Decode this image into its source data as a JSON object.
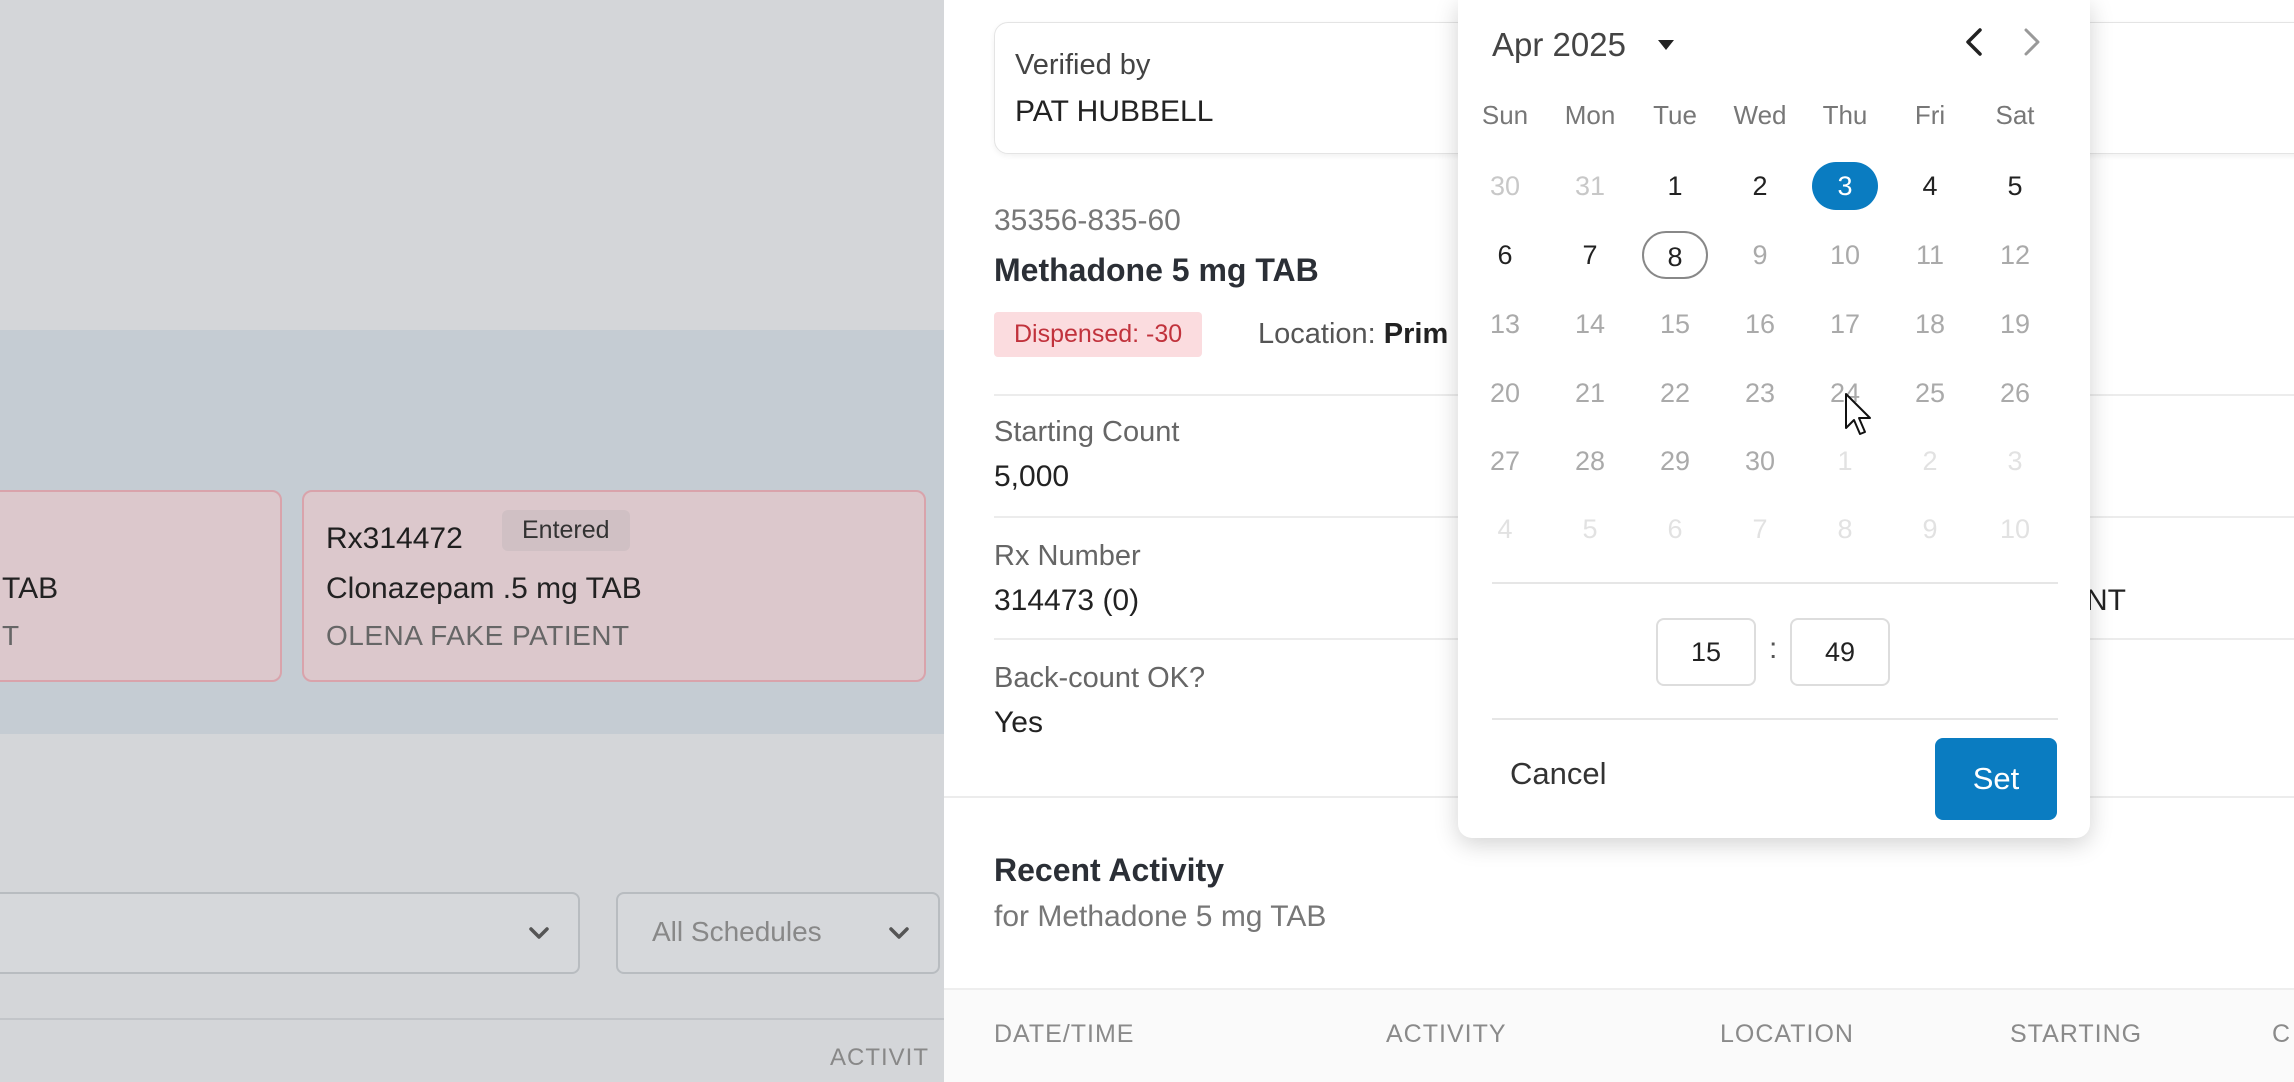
{
  "background": {
    "card_left": {
      "drug_fragment": "TAB",
      "patient_fragment": "T"
    },
    "card_right": {
      "rx_number": "Rx314472",
      "status": "Entered",
      "drug": "Clonazepam .5 mg TAB",
      "patient": "OLENA FAKE PATIENT"
    },
    "schedule_select": {
      "value": "All Schedules"
    },
    "column_fragment": "ACTIVIT"
  },
  "panel": {
    "verified_label": "Verified by",
    "verified_value": "PAT HUBBELL",
    "ndc": "35356-835-60",
    "drug_title": "Methadone 5 mg TAB",
    "dispensed_badge": "Dispensed: -30",
    "location_label": "Location:",
    "location_value": "Prim",
    "starting_count_label": "Starting Count",
    "starting_count_value": "5,000",
    "rx_number_label": "Rx Number",
    "rx_number_value": "314473 (0)",
    "right_fragment": "NT",
    "backcount_label": "Back-count OK?",
    "backcount_value": "Yes",
    "recent_title": "Recent Activity",
    "recent_subtitle": "for Methadone 5 mg TAB",
    "table_headers": [
      "DATE/TIME",
      "ACTIVITY",
      "LOCATION",
      "STARTING",
      "C"
    ]
  },
  "date_picker": {
    "month_label": "Apr 2025",
    "weekdays": [
      "Sun",
      "Mon",
      "Tue",
      "Wed",
      "Thu",
      "Fri",
      "Sat"
    ],
    "weeks": [
      [
        {
          "d": "30",
          "s": "muted"
        },
        {
          "d": "31",
          "s": "muted"
        },
        {
          "d": "1",
          "s": "normal"
        },
        {
          "d": "2",
          "s": "normal"
        },
        {
          "d": "3",
          "s": "selected"
        },
        {
          "d": "4",
          "s": "normal"
        },
        {
          "d": "5",
          "s": "normal"
        }
      ],
      [
        {
          "d": "6",
          "s": "normal"
        },
        {
          "d": "7",
          "s": "normal"
        },
        {
          "d": "8",
          "s": "today"
        },
        {
          "d": "9",
          "s": "gray"
        },
        {
          "d": "10",
          "s": "gray"
        },
        {
          "d": "11",
          "s": "gray"
        },
        {
          "d": "12",
          "s": "gray"
        }
      ],
      [
        {
          "d": "13",
          "s": "gray"
        },
        {
          "d": "14",
          "s": "gray"
        },
        {
          "d": "15",
          "s": "gray"
        },
        {
          "d": "16",
          "s": "gray"
        },
        {
          "d": "17",
          "s": "gray"
        },
        {
          "d": "18",
          "s": "gray"
        },
        {
          "d": "19",
          "s": "gray"
        }
      ],
      [
        {
          "d": "20",
          "s": "gray"
        },
        {
          "d": "21",
          "s": "gray"
        },
        {
          "d": "22",
          "s": "gray"
        },
        {
          "d": "23",
          "s": "gray"
        },
        {
          "d": "24",
          "s": "gray"
        },
        {
          "d": "25",
          "s": "gray"
        },
        {
          "d": "26",
          "s": "gray"
        }
      ],
      [
        {
          "d": "27",
          "s": "gray"
        },
        {
          "d": "28",
          "s": "gray"
        },
        {
          "d": "29",
          "s": "gray"
        },
        {
          "d": "30",
          "s": "gray"
        },
        {
          "d": "1",
          "s": "faint"
        },
        {
          "d": "2",
          "s": "faint"
        },
        {
          "d": "3",
          "s": "faint"
        }
      ],
      [
        {
          "d": "4",
          "s": "faint"
        },
        {
          "d": "5",
          "s": "faint"
        },
        {
          "d": "6",
          "s": "faint"
        },
        {
          "d": "7",
          "s": "faint"
        },
        {
          "d": "8",
          "s": "faint"
        },
        {
          "d": "9",
          "s": "faint"
        },
        {
          "d": "10",
          "s": "faint"
        }
      ]
    ],
    "hour": "15",
    "minute": "49",
    "time_separator": ":",
    "cancel_label": "Cancel",
    "set_label": "Set",
    "accent_color": "#0a7cc1"
  }
}
